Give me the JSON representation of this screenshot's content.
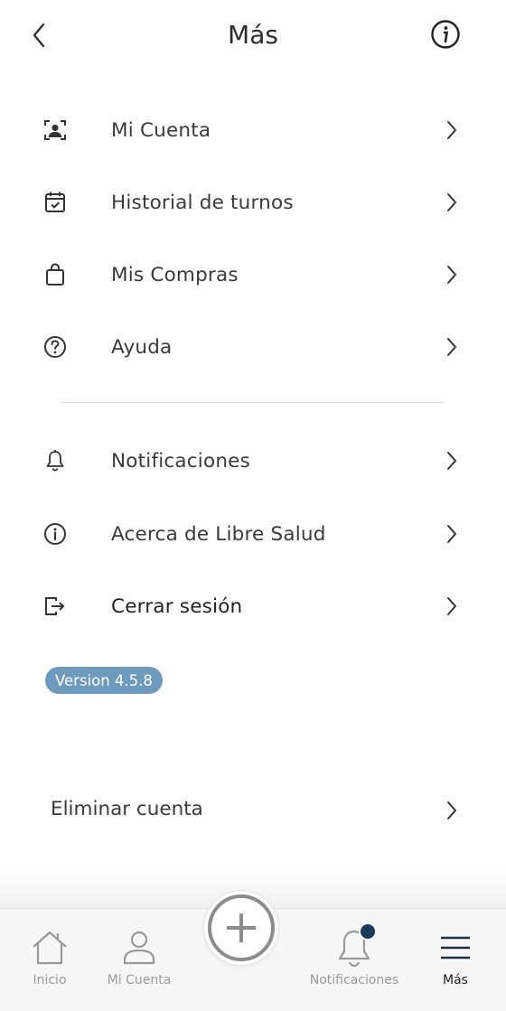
{
  "header": {
    "title": "Más",
    "back_icon": "chevron-left-icon",
    "info_icon": "info-circle-icon"
  },
  "menu": {
    "primary": [
      {
        "label": "Mi Cuenta",
        "icon": "user-card-icon"
      },
      {
        "label": "Historial de turnos",
        "icon": "calendar-check-icon"
      },
      {
        "label": "Mis Compras",
        "icon": "shopping-bag-icon"
      },
      {
        "label": "Ayuda",
        "icon": "help-circle-icon"
      }
    ],
    "secondary": [
      {
        "label": "Notificaciones",
        "icon": "bell-icon"
      },
      {
        "label": "Acerca de Libre Salud",
        "icon": "info-circle-icon"
      },
      {
        "label": "Cerrar sesión",
        "icon": "logout-icon"
      }
    ]
  },
  "version_badge": "Version 4.5.8",
  "delete_account": "Eliminar cuenta",
  "tabbar": {
    "tabs": [
      {
        "label": "Inicio",
        "icon": "home-icon",
        "active": false
      },
      {
        "label": "Mi Cuenta",
        "icon": "user-icon",
        "active": false
      },
      {
        "label": "Notificaciones",
        "icon": "bell-icon",
        "active": false,
        "badge_dot": true
      },
      {
        "label": "Más",
        "icon": "hamburger-menu-icon",
        "active": true
      }
    ],
    "fab_icon": "plus-icon"
  },
  "colors": {
    "badge_bg": "#6e9bbd",
    "notification_dot": "#1a3a5c",
    "tabbar_bg": "#f7f7f7",
    "text": "#3a3a3a"
  }
}
